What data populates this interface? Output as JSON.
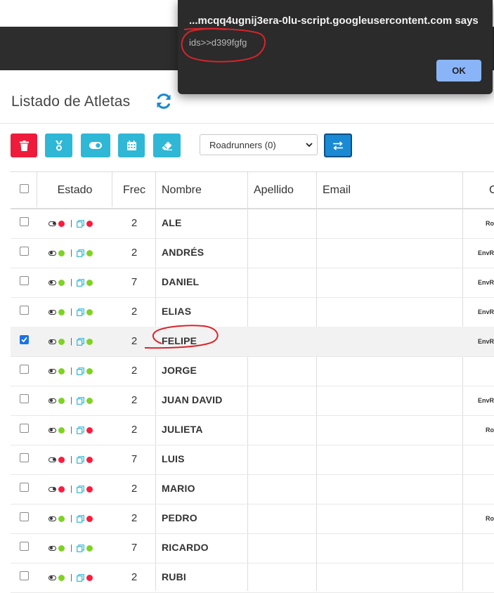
{
  "page": {
    "title": "Listado de Atletas"
  },
  "toolbar": {
    "dropdown_value": "Roadrunners (0)"
  },
  "table": {
    "headers": {
      "estado": "Estado",
      "frec": "Frec",
      "nombre": "Nombre",
      "apellido": "Apellido",
      "email": "Email",
      "cut": "C"
    },
    "rows": [
      {
        "freq": "2",
        "name": "ALE",
        "toggle": "off",
        "status2": "red",
        "extra": "Ro",
        "selected": false
      },
      {
        "freq": "2",
        "name": "ANDRÉS",
        "toggle": "on",
        "status2": "green",
        "extra": "EnvR",
        "selected": false
      },
      {
        "freq": "7",
        "name": "DANIEL",
        "toggle": "on",
        "status2": "green",
        "extra": "EnvR",
        "selected": false
      },
      {
        "freq": "2",
        "name": "ELIAS",
        "toggle": "on",
        "status2": "green",
        "extra": "EnvR",
        "selected": false
      },
      {
        "freq": "2",
        "name": "FELIPE",
        "toggle": "on",
        "status2": "green",
        "extra": "EnvR",
        "selected": true
      },
      {
        "freq": "2",
        "name": "JORGE",
        "toggle": "on",
        "status2": "green",
        "extra": "",
        "selected": false
      },
      {
        "freq": "2",
        "name": "JUAN DAVID",
        "toggle": "on",
        "status2": "green",
        "extra": "EnvR",
        "selected": false
      },
      {
        "freq": "2",
        "name": "JULIETA",
        "toggle": "on",
        "status2": "red",
        "extra": "Ro",
        "selected": false
      },
      {
        "freq": "7",
        "name": "LUIS",
        "toggle": "off",
        "status2": "red",
        "extra": "",
        "selected": false
      },
      {
        "freq": "2",
        "name": "MARIO",
        "toggle": "off",
        "status2": "red",
        "extra": "",
        "selected": false
      },
      {
        "freq": "2",
        "name": "PEDRO",
        "toggle": "on",
        "status2": "red",
        "extra": "Ro",
        "selected": false
      },
      {
        "freq": "7",
        "name": "RICARDO",
        "toggle": "on",
        "status2": "green",
        "extra": "",
        "selected": false
      },
      {
        "freq": "2",
        "name": "RUBI",
        "toggle": "on",
        "status2": "red",
        "extra": "",
        "selected": false
      }
    ],
    "separator": "|"
  },
  "dialog": {
    "title": "...mcqq4ugnij3era-0lu-script.googleusercontent.com says",
    "message": "ids>>d399fgfg",
    "ok_label": "OK"
  },
  "colors": {
    "danger": "#ee1b3b",
    "info": "#2fb7d6",
    "primary": "#1a8ad4",
    "status_green": "#7ed321",
    "status_red": "#ff1a3c",
    "annotation": "#d9232a"
  }
}
